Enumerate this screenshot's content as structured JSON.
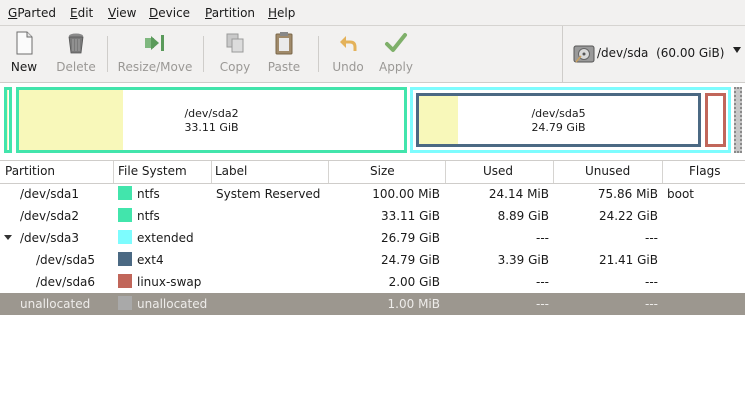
{
  "menubar": {
    "items": [
      {
        "ul": "G",
        "rest": "Parted"
      },
      {
        "ul": "E",
        "rest": "dit"
      },
      {
        "ul": "V",
        "rest": "iew"
      },
      {
        "ul": "D",
        "rest": "evice"
      },
      {
        "ul": "P",
        "rest": "artition"
      },
      {
        "ul": "H",
        "rest": "elp"
      }
    ]
  },
  "toolbar": {
    "new_label": "New",
    "delete_label": "Delete",
    "resize_label": "Resize/Move",
    "copy_label": "Copy",
    "paste_label": "Paste",
    "undo_label": "Undo",
    "apply_label": "Apply"
  },
  "device": {
    "path": "/dev/sda",
    "size": "(60.00 GiB)"
  },
  "diskmap": {
    "sda2": {
      "name": "/dev/sda2",
      "size": "33.11 GiB",
      "used_fraction": 0.27
    },
    "sda5": {
      "name": "/dev/sda5",
      "size": "24.79 GiB",
      "used_fraction": 0.14
    }
  },
  "colors": {
    "ntfs": "#42e5ac",
    "extended": "#7dfcfe",
    "ext4": "#4b6983",
    "linux_swap": "#c1665a",
    "unallocated": "#a9a9a9",
    "used_fill": "#f8f8ba"
  },
  "table": {
    "headers": {
      "partition": "Partition",
      "filesystem": "File System",
      "label": "Label",
      "size": "Size",
      "used": "Used",
      "unused": "Unused",
      "flags": "Flags"
    },
    "rows": [
      {
        "partition": "/dev/sda1",
        "fs": "ntfs",
        "label": "System Reserved",
        "size": "100.00 MiB",
        "used": "24.14 MiB",
        "unused": "75.86 MiB",
        "flags": "boot"
      },
      {
        "partition": "/dev/sda2",
        "fs": "ntfs",
        "label": "",
        "size": "33.11 GiB",
        "used": "8.89 GiB",
        "unused": "24.22 GiB",
        "flags": ""
      },
      {
        "partition": "/dev/sda3",
        "fs": "extended",
        "label": "",
        "size": "26.79 GiB",
        "used": "---",
        "unused": "---",
        "flags": ""
      },
      {
        "partition": "/dev/sda5",
        "fs": "ext4",
        "label": "",
        "size": "24.79 GiB",
        "used": "3.39 GiB",
        "unused": "21.41 GiB",
        "flags": ""
      },
      {
        "partition": "/dev/sda6",
        "fs": "linux-swap",
        "label": "",
        "size": "2.00 GiB",
        "used": "---",
        "unused": "---",
        "flags": ""
      },
      {
        "partition": "unallocated",
        "fs": "unallocated",
        "label": "",
        "size": "1.00 MiB",
        "used": "---",
        "unused": "---",
        "flags": ""
      }
    ]
  }
}
